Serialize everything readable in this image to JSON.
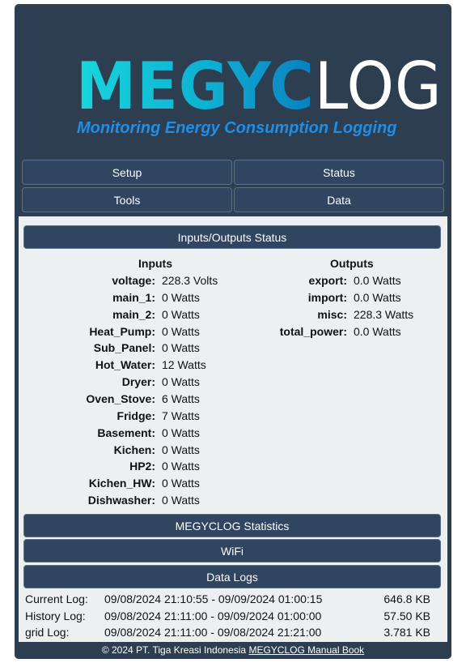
{
  "header": {
    "logo_part1": "MEGYC",
    "logo_part2": "LOG",
    "tagline": "Monitoring Energy Consumption Logging"
  },
  "nav": {
    "setup": "Setup",
    "status": "Status",
    "tools": "Tools",
    "data": "Data"
  },
  "io_status": {
    "title": "Inputs/Outputs Status",
    "inputs_title": "Inputs",
    "outputs_title": "Outputs",
    "inputs": [
      {
        "label": "voltage:",
        "value": "228.3 Volts"
      },
      {
        "label": "main_1:",
        "value": "0 Watts"
      },
      {
        "label": "main_2:",
        "value": "0 Watts"
      },
      {
        "label": "Heat_Pump:",
        "value": "0 Watts"
      },
      {
        "label": "Sub_Panel:",
        "value": "0 Watts"
      },
      {
        "label": "Hot_Water:",
        "value": "12 Watts"
      },
      {
        "label": "Dryer:",
        "value": "0 Watts"
      },
      {
        "label": "Oven_Stove:",
        "value": "6 Watts"
      },
      {
        "label": "Fridge:",
        "value": "7 Watts"
      },
      {
        "label": "Basement:",
        "value": "0 Watts"
      },
      {
        "label": "Kichen:",
        "value": "0 Watts"
      },
      {
        "label": "HP2:",
        "value": "0 Watts"
      },
      {
        "label": "Kichen_HW:",
        "value": "0 Watts"
      },
      {
        "label": "Dishwasher:",
        "value": "0 Watts"
      }
    ],
    "outputs": [
      {
        "label": "export:",
        "value": "0.0 Watts"
      },
      {
        "label": "import:",
        "value": "0.0 Watts"
      },
      {
        "label": "misc:",
        "value": "228.3 Watts"
      },
      {
        "label": "total_power:",
        "value": "0.0 Watts"
      }
    ]
  },
  "sections": {
    "statistics": "MEGYCLOG Statistics",
    "wifi": "WiFi",
    "data_logs": "Data Logs"
  },
  "logs": [
    {
      "name": "Current Log:",
      "range": "09/08/2024 21:10:55 - 09/09/2024 01:00:15",
      "size": "646.8 KB"
    },
    {
      "name": "History Log:",
      "range": "09/08/2024 21:11:00 - 09/09/2024 01:00:00",
      "size": "57.50 KB"
    },
    {
      "name": "grid Log:",
      "range": "09/08/2024 21:11:00 - 09/08/2024 21:21:00",
      "size": "3.781 KB"
    }
  ],
  "footer": {
    "copyright": "© 2024 PT. Tiga Kreasi Indonesia",
    "manual_link": "MEGYCLOG Manual Book"
  }
}
